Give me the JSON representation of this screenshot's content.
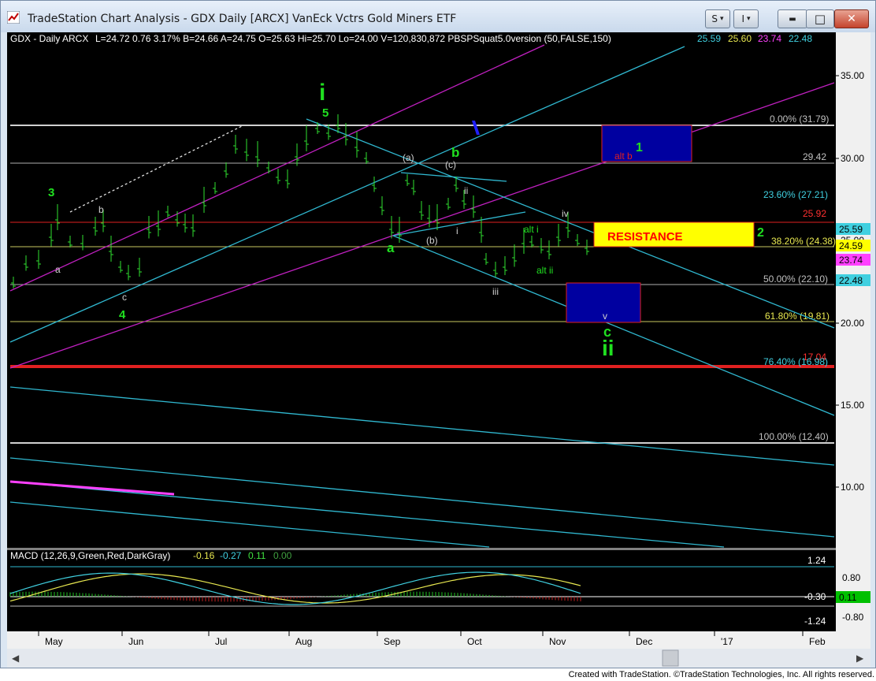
{
  "window": {
    "title": "TradeStation Chart Analysis - GDX Daily [ARCX] VanEck Vctrs Gold Miners ETF",
    "btn_s": "S",
    "btn_i": "I",
    "dropdown_glyph": "▾",
    "minimize_glyph": "▬",
    "maximize_glyph": "□",
    "close_glyph": "✕"
  },
  "header": {
    "symbol": "GDX - Daily  ARCX",
    "quote": "L=24.72  0.76  3.17%   B=24.66  A=24.75  O=25.63  Hi=25.70  Lo=24.00  V=120,830,872  PBSPSquat5.0version (50,FALSE,150)",
    "ind_values": [
      {
        "text": "25.59",
        "color": "#40d0e0"
      },
      {
        "text": "25.60",
        "color": "#e8e850"
      },
      {
        "text": "23.74",
        "color": "#ff40ff"
      },
      {
        "text": "22.48",
        "color": "#40d0e0"
      }
    ]
  },
  "price_axis": {
    "labels": [
      "35.00",
      "30.00",
      "25.00",
      "20.00",
      "15.00",
      "10.00"
    ],
    "markers": [
      {
        "text": "25.59",
        "bg": "#40d0e0",
        "fg": "#000000"
      },
      {
        "text": "24.59",
        "bg": "#ffff00",
        "fg": "#000000"
      },
      {
        "text": "23.74",
        "bg": "#ff40ff",
        "fg": "#000000"
      },
      {
        "text": "22.48",
        "bg": "#40d0e0",
        "fg": "#000000"
      }
    ]
  },
  "fib_levels": [
    {
      "label": "0.00% (31.79)",
      "color": "#c0c0c0"
    },
    {
      "label": "29.42",
      "color": "#c0c0c0"
    },
    {
      "label": "23.60% (27.21)",
      "color": "#40d0e0"
    },
    {
      "label": "25.92",
      "color": "#ff3030"
    },
    {
      "label": "38.20% (24.38)",
      "color": "#e8e850"
    },
    {
      "label": "50.00% (22.10)",
      "color": "#c0c0c0"
    },
    {
      "label": "61.80% (19.81)",
      "color": "#e8e850"
    },
    {
      "label": "17.04",
      "color": "#ff3030"
    },
    {
      "label": "76.40% (16.98)",
      "color": "#40d0e0"
    },
    {
      "label": "100.00% (12.40)",
      "color": "#c0c0c0"
    }
  ],
  "wave_labels": {
    "big_i": "i",
    "five": "5",
    "three": "3",
    "four": "4",
    "a_small_1": "a",
    "b_small_1": "b",
    "c_small_1": "c",
    "a_paren": "(a)",
    "c_paren": "(c)",
    "b_paren": "(b)",
    "b_green": "b",
    "a_green": "a",
    "ii_small": "ii",
    "i_small": "i",
    "iii_small": "iii",
    "iv_small": "iv",
    "alt_i": "alt i",
    "alt_ii": "alt ii",
    "v_small": "v",
    "c_green": "c",
    "big_ii": "ii",
    "one_green": "1",
    "alt_b": "alt b",
    "two_green": "2",
    "resistance": "RESISTANCE"
  },
  "macd": {
    "legend": "MACD (12,26,9,Green,Red,DarkGray)",
    "values": [
      {
        "text": "-0.16",
        "color": "#e8e850"
      },
      {
        "text": "-0.27",
        "color": "#40d0e0"
      },
      {
        "text": "0.11",
        "color": "#40e040"
      },
      {
        "text": "0.00",
        "color": "#40a040"
      }
    ],
    "axis_labels": [
      "0.80",
      "-0.80"
    ],
    "inner_labels": [
      "1.24",
      "-0.30",
      "-1.24"
    ],
    "marker": {
      "text": "0.11",
      "bg": "#00c000",
      "fg": "#000000"
    }
  },
  "time_axis": {
    "months": [
      "May",
      "Jun",
      "Jul",
      "Aug",
      "Sep",
      "Oct",
      "Nov",
      "Dec",
      "'17",
      "Feb"
    ]
  },
  "scrollbar": {
    "left_arrow": "◀",
    "right_arrow": "▶"
  },
  "footer": {
    "text": "Created with TradeStation. ©TradeStation Technologies, Inc. All rights reserved."
  },
  "colors": {
    "background": "#000000",
    "green_label": "#20e020",
    "cyan_line": "#30b8d0",
    "magenta_line": "#c020c0",
    "red_line": "#e02020",
    "resistance_box": "#ffff00",
    "resistance_text": "#ff0000",
    "target_box": "#0000a0"
  }
}
